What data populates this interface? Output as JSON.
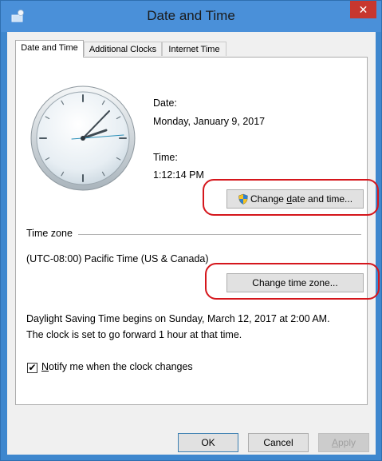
{
  "window": {
    "title": "Date and Time",
    "close_glyph": "✕"
  },
  "tabs": [
    {
      "label": "Date and Time",
      "active": true
    },
    {
      "label": "Additional Clocks",
      "active": false
    },
    {
      "label": "Internet Time",
      "active": false
    }
  ],
  "date": {
    "label": "Date:",
    "value": "Monday, January 9, 2017"
  },
  "time": {
    "label": "Time:",
    "value": "1:12:14 PM"
  },
  "change_datetime_button": {
    "pre": "Change ",
    "underline": "d",
    "post": "ate and time...",
    "icon": "shield-icon"
  },
  "timezone": {
    "section_label": "Time zone",
    "value": "(UTC-08:00) Pacific Time (US & Canada)",
    "button_label": "Change time zone..."
  },
  "dst": {
    "line1": "Daylight Saving Time begins on Sunday, March 12, 2017 at 2:00 AM.",
    "line2": "The clock is set to go forward 1 hour at that time."
  },
  "notify": {
    "checked": true,
    "check_glyph": "✔",
    "underline": "N",
    "rest": "otify me when the clock changes"
  },
  "footer": {
    "ok": "OK",
    "cancel": "Cancel",
    "apply_underline": "A",
    "apply_rest": "pply"
  },
  "colors": {
    "titlebar": "#4a90d9",
    "close": "#c7372f",
    "highlight": "#d5161c"
  }
}
